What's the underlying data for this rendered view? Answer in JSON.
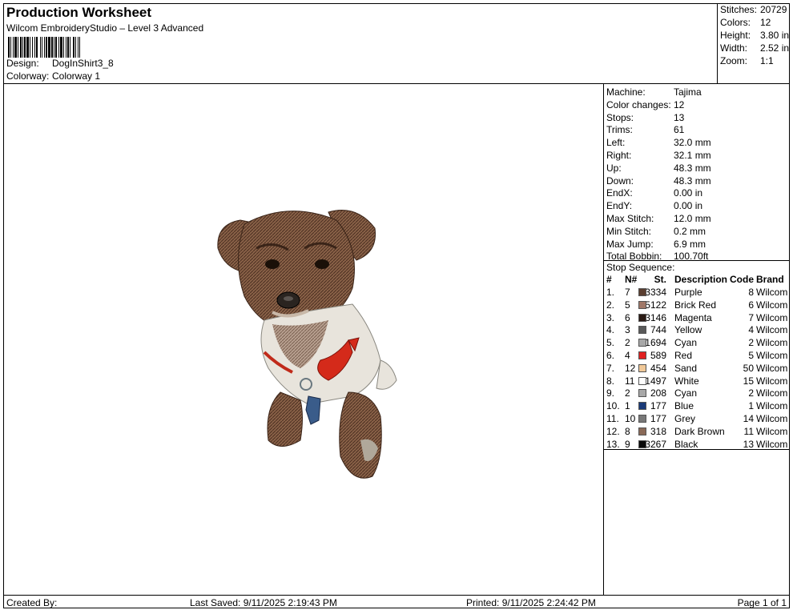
{
  "header": {
    "title": "Production Worksheet",
    "subtitle": "Wilcom EmbroideryStudio – Level 3 Advanced",
    "design_label": "Design:",
    "design_value": "DogInShirt3_8",
    "colorway_label": "Colorway:",
    "colorway_value": "Colorway 1"
  },
  "stats": {
    "stitches_label": "Stitches:",
    "stitches_value": "20729",
    "colors_label": "Colors:",
    "colors_value": "12",
    "height_label": "Height:",
    "height_value": "3.80 in",
    "width_label": "Width:",
    "width_value": "2.52 in",
    "zoom_label": "Zoom:",
    "zoom_value": "1:1"
  },
  "machine": [
    {
      "k": "Machine:",
      "v": "Tajima"
    },
    {
      "k": "Color changes:",
      "v": "12"
    },
    {
      "k": "Stops:",
      "v": "13"
    },
    {
      "k": "Trims:",
      "v": "61"
    },
    {
      "k": "Left:",
      "v": "32.0 mm"
    },
    {
      "k": "Right:",
      "v": "32.1 mm"
    },
    {
      "k": "Up:",
      "v": "48.3 mm"
    },
    {
      "k": "Down:",
      "v": "48.3 mm"
    },
    {
      "k": "EndX:",
      "v": "0.00 in"
    },
    {
      "k": "EndY:",
      "v": "0.00 in"
    },
    {
      "k": "Max Stitch:",
      "v": "12.0 mm"
    },
    {
      "k": "Min Stitch:",
      "v": "0.2 mm"
    },
    {
      "k": "Max Jump:",
      "v": "6.9 mm"
    },
    {
      "k": "Total Bobbin:",
      "v": "100.70ft"
    }
  ],
  "stop_sequence": {
    "title": "Stop Sequence:",
    "headers": {
      "num": "#",
      "n": "N#",
      "st": "St.",
      "desc": "Description",
      "code": "Code",
      "brand": "Brand"
    },
    "rows": [
      {
        "num": "1.",
        "n": "7",
        "color": "#5a3e30",
        "st": "3334",
        "desc": "Purple",
        "code": "8",
        "brand": "Wilcom"
      },
      {
        "num": "2.",
        "n": "5",
        "color": "#a07868",
        "st": "5122",
        "desc": "Brick Red",
        "code": "6",
        "brand": "Wilcom"
      },
      {
        "num": "3.",
        "n": "6",
        "color": "#2a1a14",
        "st": "3146",
        "desc": "Magenta",
        "code": "7",
        "brand": "Wilcom"
      },
      {
        "num": "4.",
        "n": "3",
        "color": "#5a5a5a",
        "st": "744",
        "desc": "Yellow",
        "code": "4",
        "brand": "Wilcom"
      },
      {
        "num": "5.",
        "n": "2",
        "color": "#a8a8a8",
        "st": "1694",
        "desc": "Cyan",
        "code": "2",
        "brand": "Wilcom"
      },
      {
        "num": "6.",
        "n": "4",
        "color": "#e02020",
        "st": "589",
        "desc": "Red",
        "code": "5",
        "brand": "Wilcom"
      },
      {
        "num": "7.",
        "n": "12",
        "color": "#f0c898",
        "st": "454",
        "desc": "Sand",
        "code": "50",
        "brand": "Wilcom"
      },
      {
        "num": "8.",
        "n": "11",
        "color": "#ffffff",
        "st": "1497",
        "desc": "White",
        "code": "15",
        "brand": "Wilcom"
      },
      {
        "num": "9.",
        "n": "2",
        "color": "#a8a8a8",
        "st": "208",
        "desc": "Cyan",
        "code": "2",
        "brand": "Wilcom"
      },
      {
        "num": "10.",
        "n": "1",
        "color": "#1a3a78",
        "st": "177",
        "desc": "Blue",
        "code": "1",
        "brand": "Wilcom"
      },
      {
        "num": "11.",
        "n": "10",
        "color": "#787878",
        "st": "177",
        "desc": "Grey",
        "code": "14",
        "brand": "Wilcom"
      },
      {
        "num": "12.",
        "n": "8",
        "color": "#8a6a58",
        "st": "318",
        "desc": "Dark Brown",
        "code": "11",
        "brand": "Wilcom"
      },
      {
        "num": "13.",
        "n": "9",
        "color": "#0a0a0a",
        "st": "3267",
        "desc": "Black",
        "code": "13",
        "brand": "Wilcom"
      }
    ]
  },
  "footer": {
    "created_by": "Created By:",
    "last_saved": "Last Saved: 9/11/2025 2:19:43 PM",
    "printed": "Printed: 9/11/2025 2:24:42 PM",
    "page": "Page 1 of 1"
  },
  "artwork": {
    "icon": "dog-embroidery-preview"
  }
}
